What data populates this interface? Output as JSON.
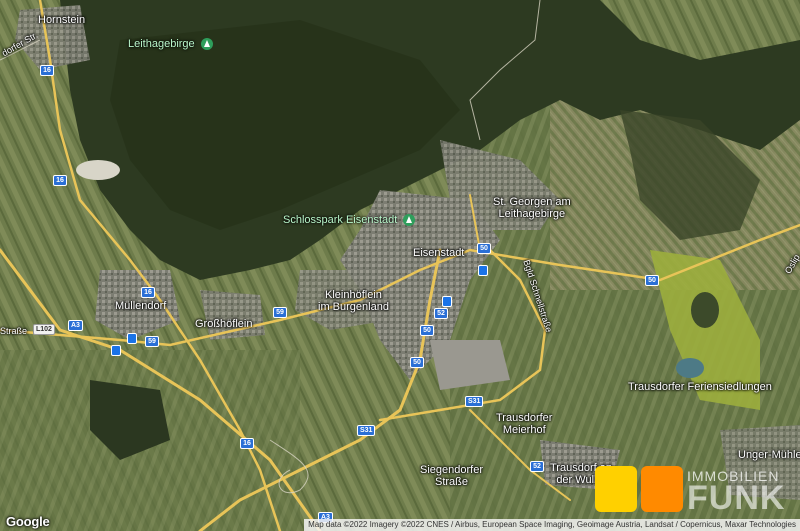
{
  "places": {
    "hornstein": "Hornstein",
    "mullendorf": "Müllendorf",
    "grosshoflein": "Großhöflein",
    "kleinhoflein_1": "Kleinhöflein",
    "kleinhoflein_2": "im Burgenland",
    "eisenstadt": "Eisenstadt",
    "st_georgen_1": "St. Georgen am",
    "st_georgen_2": "Leithagebirge",
    "trausdorfer_fs": "Trausdorfer Feriensiedlungen",
    "trausdorfer_mh_1": "Trausdorfer",
    "trausdorfer_mh_2": "Meierhof",
    "siegendorfer_1": "Siegendorfer",
    "siegendorfer_2": "Straße",
    "trausdorf_1": "Trausdorf an",
    "trausdorf_2": "der Wulka",
    "unger_muhle": "Unger-Mühle",
    "road_bgld": "Bgld Schnellstraße",
    "road_left_top": "dorfer Str.",
    "road_right": "Oslip",
    "road_left_mid": "Straße"
  },
  "pois": {
    "leithagebirge": "Leithagebirge",
    "schlosspark": "Schlosspark Eisenstadt"
  },
  "shields": {
    "r16a": "16",
    "r16b": "16",
    "r16c": "16",
    "r16d": "16",
    "r59a": "59",
    "r59b": "59",
    "a3": "A3",
    "l102": "L102",
    "r50a": "50",
    "r50b": "50",
    "r50c": "50",
    "r50d": "50",
    "r52a": "52",
    "r52b": "52",
    "s31a": "S31",
    "s31b": "S31",
    "a50": "A3"
  },
  "google_logo": "Google",
  "attribution": "Map data ©2022 Imagery ©2022 CNES / Airbus, European Space Imaging, Geoimage Austria, Landsat / Copernicus, Maxar Technologies",
  "watermark": {
    "top": "IMMOBILIEN",
    "bottom": "FUNK"
  },
  "colors": {
    "forest": "#2f3a22",
    "fields": "#6b7a4a",
    "urban": "#8a8a80",
    "road": "#e8c458",
    "shield_blue": "#2a6fd6",
    "brand_yellow": "#ffd000",
    "brand_orange": "#ff8a00"
  }
}
